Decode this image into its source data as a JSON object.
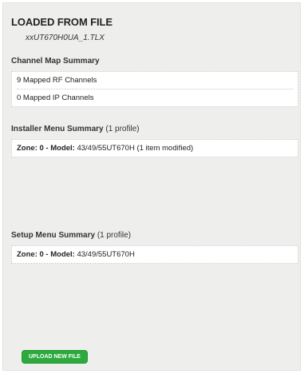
{
  "header": {
    "title": "LOADED FROM FILE",
    "filename": "xxUT670H0UA_1.TLX"
  },
  "channel_map": {
    "heading": "Channel Map Summary",
    "rows": [
      "9 Mapped RF Channels",
      "0 Mapped IP Channels"
    ]
  },
  "installer_menu": {
    "heading": "Installer Menu Summary",
    "count": "(1 profile)",
    "item": {
      "zone_model_label": "Zone: 0 - Model:",
      "model": "43/49/55UT670H",
      "note": "(1 item modified)"
    }
  },
  "setup_menu": {
    "heading": "Setup Menu Summary",
    "count": "(1 profile)",
    "item": {
      "zone_model_label": "Zone: 0 - Model:",
      "model": "43/49/55UT670H"
    }
  },
  "actions": {
    "upload_label": "UPLOAD NEW FILE",
    "upload_color": "#2daa3e"
  }
}
